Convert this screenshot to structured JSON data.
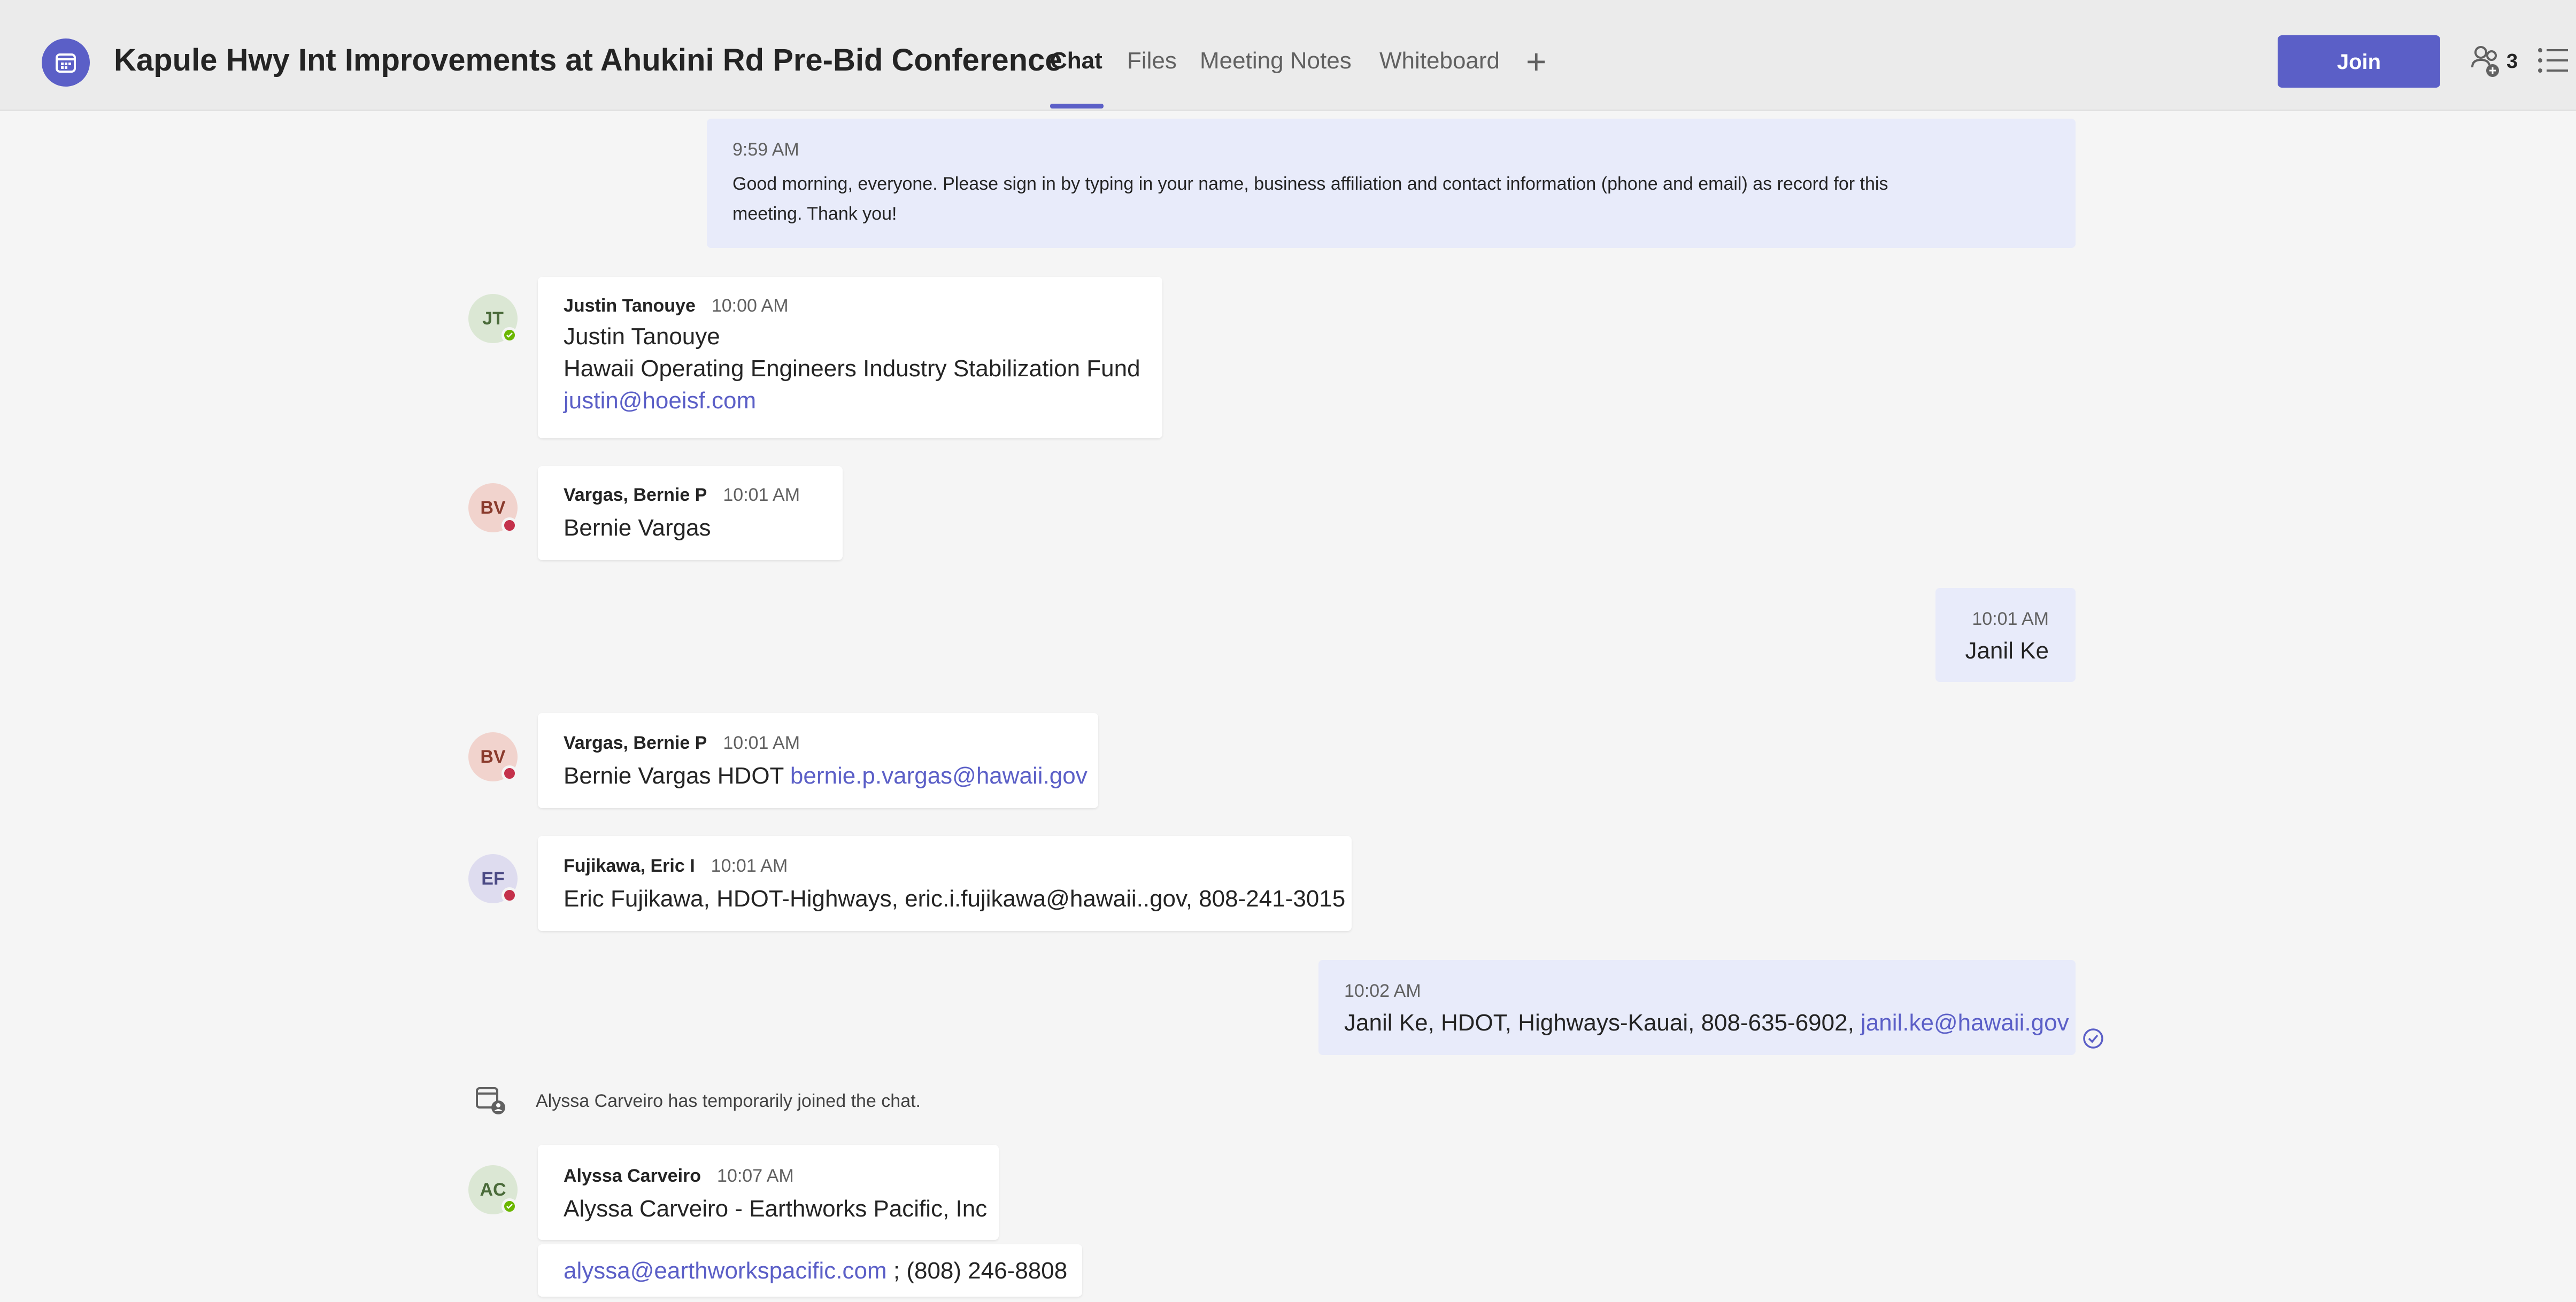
{
  "header": {
    "title": "Kapule Hwy Int Improvements at Ahukini Rd Pre-Bid Conference",
    "tabs": [
      {
        "label": "Chat",
        "active": true
      },
      {
        "label": "Files"
      },
      {
        "label": "Meeting Notes"
      },
      {
        "label": "Whiteboard"
      }
    ],
    "add_tab_symbol": "+",
    "join_label": "Join",
    "participant_count": "3",
    "icons": [
      "meeting-calendar-icon",
      "people-icon",
      "list-icon",
      "add-icon"
    ]
  },
  "messages": [
    {
      "time": "9:59 AM",
      "mine": true,
      "lines": [
        "Good morning, everyone.  Please sign in by typing in your name, business affiliation and contact information (phone and email) as record for this",
        "meeting.  Thank you!"
      ]
    },
    {
      "initials": "JT",
      "sender": "Justin Tanouye",
      "time": "10:00 AM",
      "presence": "available",
      "lines": [
        "Justin Tanouye",
        "Hawaii Operating Engineers Industry Stabilization Fund"
      ],
      "link": "justin@hoeisf.com"
    },
    {
      "initials": "BV",
      "sender": "Vargas, Bernie P",
      "time": "10:01 AM",
      "presence": "busy",
      "lines": [
        "Bernie Vargas"
      ]
    },
    {
      "time": "10:01 AM",
      "mine": true,
      "lines": [
        "Janil Ke"
      ]
    },
    {
      "initials": "BV",
      "sender": "Vargas, Bernie P",
      "time": "10:01 AM",
      "presence": "busy",
      "text": "Bernie Vargas HDOT ",
      "link": "bernie.p.vargas@hawaii.gov"
    },
    {
      "initials": "EF",
      "sender": "Fujikawa, Eric I",
      "time": "10:01 AM",
      "presence": "busy",
      "lines": [
        "Eric Fujikawa, HDOT-Highways, eric.i.fujikawa@hawaii..gov, 808-241-3015"
      ]
    },
    {
      "time": "10:02 AM",
      "mine": true,
      "text": "Janil Ke, HDOT, Highways-Kauai, 808-635-6902, ",
      "link": "janil.ke@hawaii.gov"
    },
    {
      "system": true,
      "text": "Alyssa Carveiro has temporarily joined the chat."
    },
    {
      "initials": "AC",
      "sender": "Alyssa Carveiro",
      "time": "10:07 AM",
      "presence": "available",
      "lines": [
        "Alyssa Carveiro - Earthworks Pacific, Inc"
      ],
      "followup_link": "alyssa@earthworkspacific.com",
      "followup_text": " ; (808) 246-8808"
    }
  ],
  "colors": {
    "accent": "#5b5fc7",
    "own_bubble": "#e8ebfa",
    "available": "#6bb700",
    "busy": "#c4314b"
  }
}
